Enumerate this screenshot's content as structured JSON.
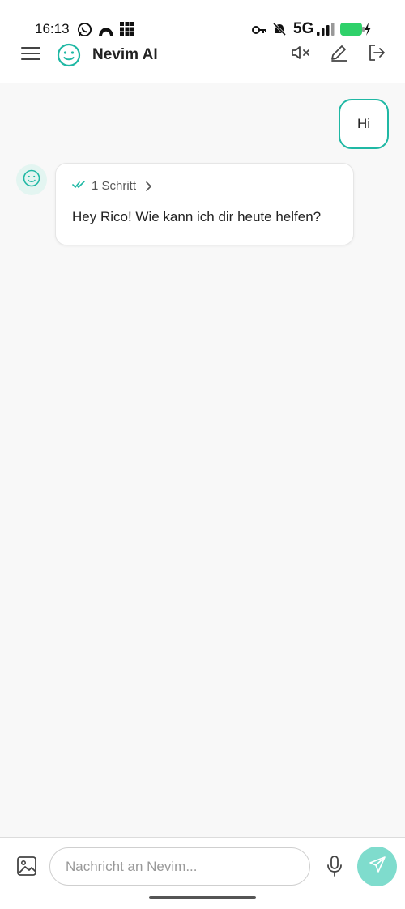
{
  "status_bar": {
    "time": "16:13",
    "network": "5G",
    "icons": [
      "whatsapp-icon",
      "app-icon",
      "grid-icon",
      "vpn-key-icon",
      "mute-icon",
      "signal-icon",
      "battery-icon"
    ],
    "battery_color": "#2fd16a"
  },
  "header": {
    "title": "Nevim AI",
    "icons": [
      "menu-icon",
      "smiley-logo-icon",
      "speaker-muted-icon",
      "edit-icon",
      "logout-icon"
    ]
  },
  "chat": {
    "messages": [
      {
        "role": "user",
        "text": "Hi"
      },
      {
        "role": "assistant",
        "steps_label": "1 Schritt",
        "text": "Hey Rico! Wie kann ich dir heute helfen?"
      }
    ]
  },
  "composer": {
    "placeholder": "Nachricht an Nevim...",
    "value": "",
    "icons": [
      "image-icon",
      "microphone-icon",
      "send-icon"
    ]
  },
  "colors": {
    "accent": "#1fb8a4",
    "send_button": "#7fdccd",
    "avatar_bg": "#e3f5f1",
    "background": "#f8f8f8"
  }
}
